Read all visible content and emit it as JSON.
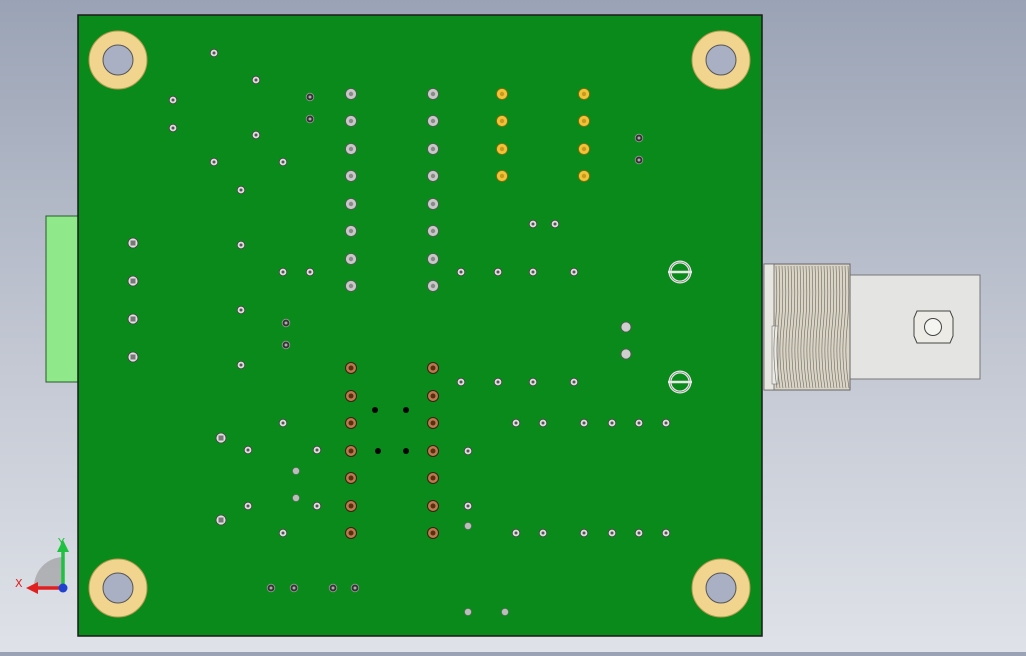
{
  "viewport": {
    "background_top": "#9aa3b5",
    "background_bottom": "#dfe2e8"
  },
  "board": {
    "color": "#0a8a1a",
    "outline": "#1a1a1a"
  },
  "mounting_hole_colors": {
    "ring": "#f1d48e",
    "hole": "#a9b0c4"
  },
  "header_connector": {
    "color": "#8fe88a"
  },
  "bnc_connector": {
    "body": "#e4e4e2",
    "thread": "#d9d4c6"
  },
  "pad_colors": {
    "silver": "#c8c8c8",
    "gold": "#f2c237",
    "copper": "#b87a4e",
    "via": "#dddddd"
  },
  "triad": {
    "x_label": "X",
    "y_label": "Y",
    "x_color": "#e02020",
    "y_color": "#20c040",
    "z_color": "#2040d0"
  }
}
